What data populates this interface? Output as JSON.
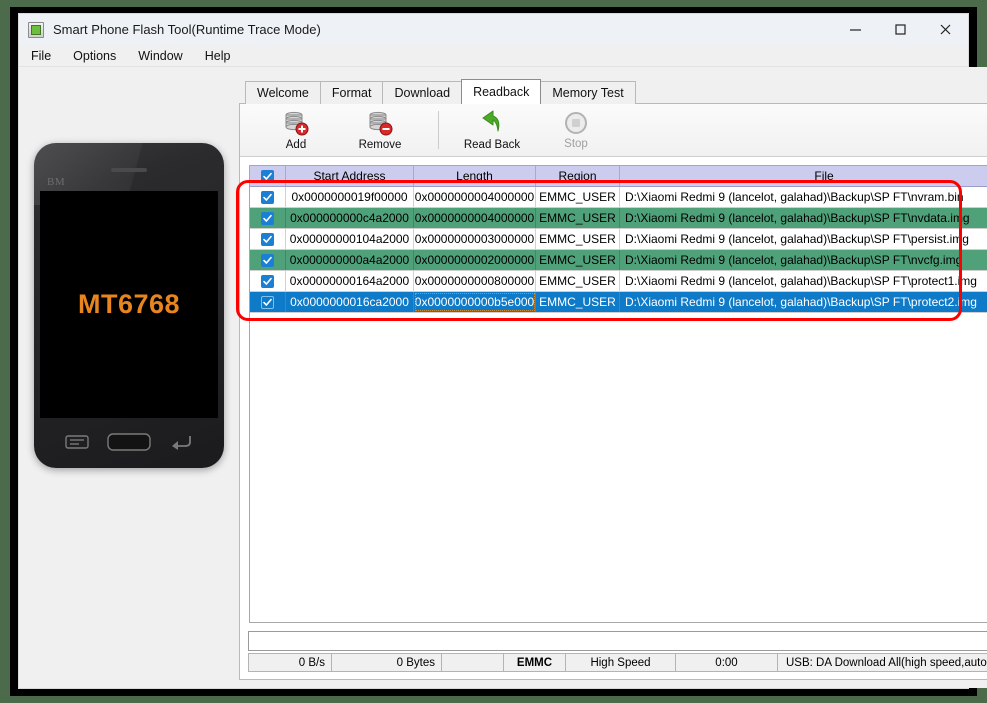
{
  "window": {
    "title": "Smart Phone Flash Tool(Runtime Trace Mode)",
    "icon": "app-icon",
    "controls": {
      "minimize": "minimize-icon",
      "maximize": "maximize-icon",
      "close": "close-icon"
    }
  },
  "menu": {
    "items": [
      {
        "label": "File"
      },
      {
        "label": "Options"
      },
      {
        "label": "Window"
      },
      {
        "label": "Help"
      }
    ]
  },
  "phone": {
    "soc_label": "MT6768",
    "watermark": "BM",
    "soc_color": "#e8851e",
    "nav": [
      {
        "name": "menu-button-icon"
      },
      {
        "name": "home-button-icon"
      },
      {
        "name": "back-button-icon"
      }
    ]
  },
  "tabs": [
    {
      "label": "Welcome",
      "active": false
    },
    {
      "label": "Format",
      "active": false
    },
    {
      "label": "Download",
      "active": false
    },
    {
      "label": "Readback",
      "active": true
    },
    {
      "label": "Memory Test",
      "active": false
    }
  ],
  "toolbar": {
    "add_label": "Add",
    "remove_label": "Remove",
    "readback_label": "Read Back",
    "stop_label": "Stop",
    "stop_disabled": true
  },
  "grid": {
    "header_checkbox_checked": true,
    "columns": [
      {
        "key": "check",
        "label": ""
      },
      {
        "key": "start_address",
        "label": "Start Address"
      },
      {
        "key": "length",
        "label": "Length"
      },
      {
        "key": "region",
        "label": "Region"
      },
      {
        "key": "file",
        "label": "File"
      }
    ],
    "rows": [
      {
        "checked": true,
        "start_address": "0x0000000019f00000",
        "length": "0x0000000004000000",
        "region": "EMMC_USER",
        "file": "D:\\Xiaomi Redmi 9 (lancelot, galahad)\\Backup\\SP FT\\nvram.bin",
        "state": "normal"
      },
      {
        "checked": true,
        "start_address": "0x000000000c4a2000",
        "length": "0x0000000004000000",
        "region": "EMMC_USER",
        "file": "D:\\Xiaomi Redmi 9 (lancelot, galahad)\\Backup\\SP FT\\nvdata.img",
        "state": "green"
      },
      {
        "checked": true,
        "start_address": "0x00000000104a2000",
        "length": "0x0000000003000000",
        "region": "EMMC_USER",
        "file": "D:\\Xiaomi Redmi 9 (lancelot, galahad)\\Backup\\SP FT\\persist.img",
        "state": "normal"
      },
      {
        "checked": true,
        "start_address": "0x000000000a4a2000",
        "length": "0x0000000002000000",
        "region": "EMMC_USER",
        "file": "D:\\Xiaomi Redmi 9 (lancelot, galahad)\\Backup\\SP FT\\nvcfg.img",
        "state": "green"
      },
      {
        "checked": true,
        "start_address": "0x00000000164a2000",
        "length": "0x0000000000800000",
        "region": "EMMC_USER",
        "file": "D:\\Xiaomi Redmi 9 (lancelot, galahad)\\Backup\\SP FT\\protect1.img",
        "state": "normal"
      },
      {
        "checked": true,
        "start_address": "0x0000000016ca2000",
        "length": "0x0000000000b5e000",
        "region": "EMMC_USER",
        "file": "D:\\Xiaomi Redmi 9 (lancelot, galahad)\\Backup\\SP FT\\protect2.img",
        "state": "selected"
      }
    ]
  },
  "annotation": {
    "color": "#ff0000",
    "shape": "rounded-rectangle"
  },
  "status": {
    "speed": "0 B/s",
    "bytes": "0 Bytes",
    "blank": "",
    "storage": "EMMC",
    "mode": "High Speed",
    "time": "0:00",
    "usb": "USB: DA Download All(high speed,auto detect)"
  }
}
